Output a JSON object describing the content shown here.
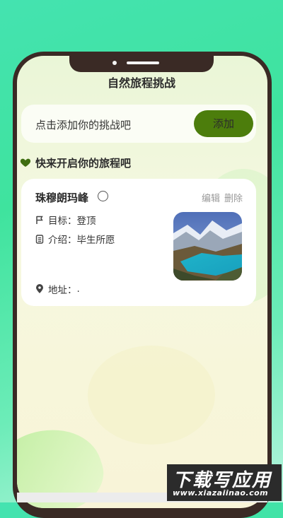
{
  "header": {
    "title": "自然旅程挑战"
  },
  "add_bar": {
    "prompt": "点击添加你的挑战吧",
    "button_label": "添加"
  },
  "section": {
    "title": "快来开启你的旅程吧"
  },
  "challenge": {
    "name": "珠穆朗玛峰",
    "edit_label": "编辑",
    "delete_label": "删除",
    "goal_label": "目标：",
    "goal_value": "登顶",
    "intro_label": "介绍：",
    "intro_value": "毕生所愿",
    "address_label": "地址：",
    "address_value": ".",
    "completed": false
  },
  "watermark": {
    "brand": "下载写应用",
    "url": "www.xiazaiinao.com"
  },
  "colors": {
    "accent": "#4c7d0c",
    "heart": "#3f6e10",
    "frame": "#3a2a25"
  }
}
